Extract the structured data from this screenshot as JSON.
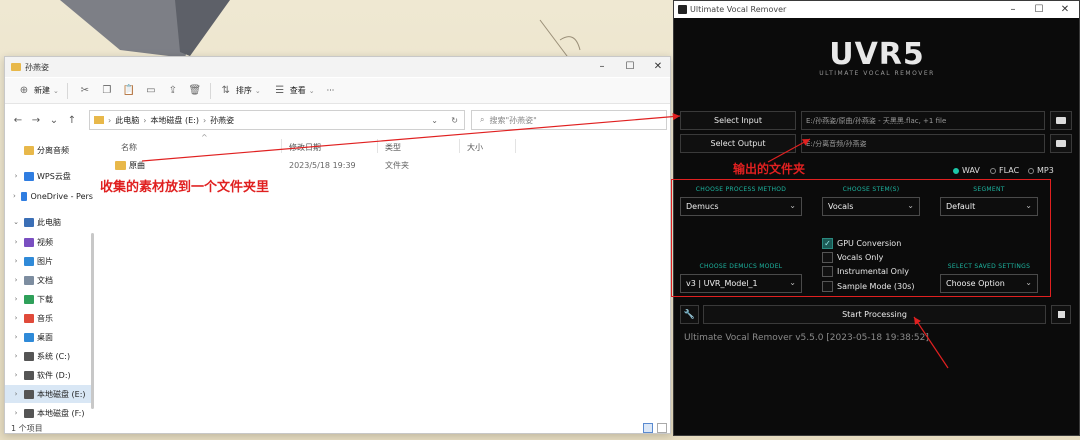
{
  "explorer": {
    "title": "孙燕姿",
    "toolbar": {
      "new_label": "新建",
      "sort_label": "排序",
      "view_label": "查看",
      "more_label": "···"
    },
    "address": {
      "crumbs": [
        "此电脑",
        "本地磁盘 (E:)",
        "孙燕姿"
      ],
      "search_placeholder": "搜索\"孙燕姿\""
    },
    "sidebar": [
      {
        "label": "分离音频",
        "icon": "folder-icon",
        "color": "#e8b84a"
      },
      {
        "label": "WPS云盘",
        "icon": "cloud-icon",
        "color": "#2f7de1"
      },
      {
        "label": "OneDrive - Pers",
        "icon": "cloud-icon",
        "color": "#2f7de1"
      },
      {
        "label": "此电脑",
        "icon": "pc-icon",
        "color": "#3b6fb6"
      },
      {
        "label": "视频",
        "icon": "video-icon",
        "color": "#7a4fc1"
      },
      {
        "label": "图片",
        "icon": "picture-icon",
        "color": "#2f8ad8"
      },
      {
        "label": "文档",
        "icon": "document-icon",
        "color": "#7d8da0"
      },
      {
        "label": "下载",
        "icon": "download-icon",
        "color": "#2fa05a"
      },
      {
        "label": "音乐",
        "icon": "music-icon",
        "color": "#e04a3a"
      },
      {
        "label": "桌面",
        "icon": "desktop-icon",
        "color": "#2f8ad8"
      },
      {
        "label": "系统 (C:)",
        "icon": "drive-icon",
        "color": "#555555"
      },
      {
        "label": "软件 (D:)",
        "icon": "drive-icon",
        "color": "#555555"
      },
      {
        "label": "本地磁盘 (E:)",
        "icon": "drive-icon",
        "color": "#555555"
      },
      {
        "label": "本地磁盘 (F:)",
        "icon": "drive-icon",
        "color": "#555555"
      }
    ],
    "columns": {
      "name": "名称",
      "date": "修改日期",
      "type": "类型",
      "size": "大小"
    },
    "files": [
      {
        "name": "原曲",
        "date": "2023/5/18 19:39",
        "type": "文件夹"
      }
    ],
    "status": "1 个项目"
  },
  "annotations": {
    "collect": "收集的素材放到一个文件夹里",
    "output": "输出的文件夹",
    "color": "#e02020"
  },
  "uvr": {
    "title": "Ultimate Vocal Remover",
    "logo_text": "UVR5",
    "logo_sub": "ULTIMATE VOCAL REMOVER",
    "select_input": "Select Input",
    "input_path": "E:/孙燕姿/原曲/孙燕姿 - 天黑黑.flac, +1 file",
    "select_output": "Select Output",
    "output_path": "E:/分离音频/孙燕姿",
    "formats": [
      "WAV",
      "FLAC",
      "MP3"
    ],
    "selected_format": "WAV",
    "process_method_title": "CHOOSE PROCESS METHOD",
    "process_method": "Demucs",
    "stems_title": "CHOOSE STEM(S)",
    "stems": "Vocals",
    "segment_title": "SEGMENT",
    "segment": "Default",
    "model_title": "CHOOSE DEMUCS MODEL",
    "model": "v3 | UVR_Model_1",
    "saved_title": "SELECT SAVED SETTINGS",
    "saved": "Choose Option",
    "options": [
      {
        "label": "GPU Conversion",
        "checked": true
      },
      {
        "label": "Vocals Only",
        "checked": false
      },
      {
        "label": "Instrumental Only",
        "checked": false
      },
      {
        "label": "Sample Mode (30s)",
        "checked": false
      }
    ],
    "start_label": "Start Processing",
    "version": "Ultimate Vocal Remover v5.5.0 [2023-05-18 19:38:52]",
    "accent": "#1dc7a8"
  }
}
